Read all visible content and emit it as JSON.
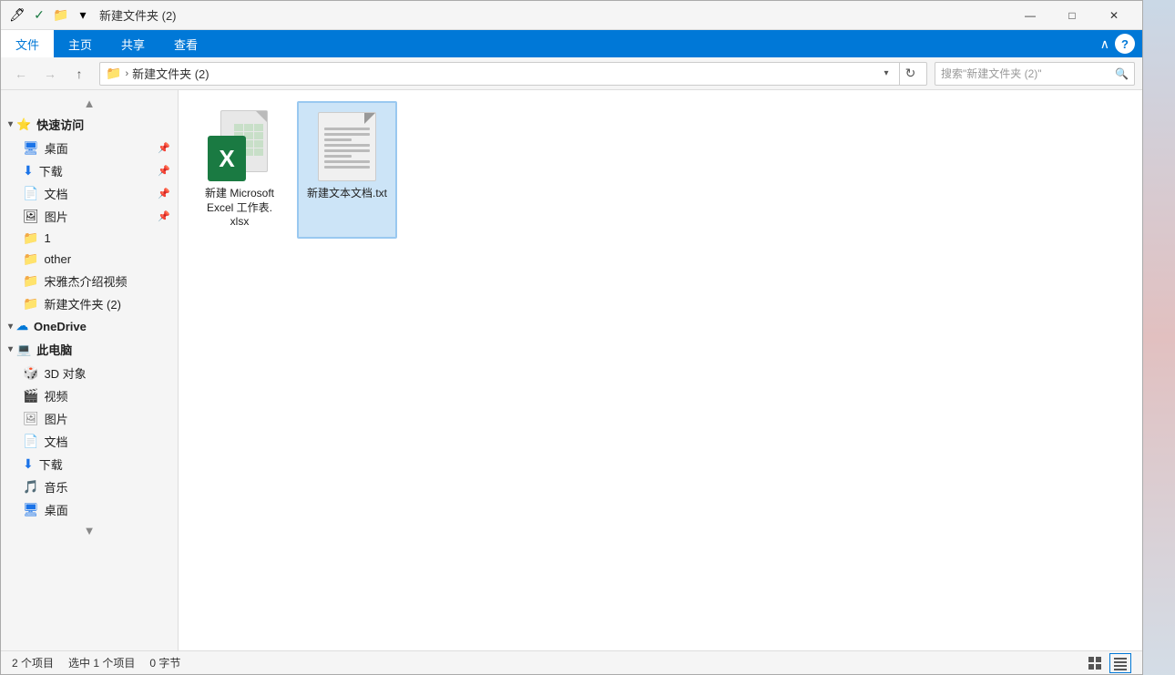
{
  "window": {
    "title": "新建文件夹 (2)",
    "titlebar_icons": [
      "🖊",
      "✓",
      "📁",
      "▾"
    ]
  },
  "menubar": {
    "items": [
      "文件",
      "主页",
      "共享",
      "查看"
    ],
    "active_index": 0
  },
  "navbar": {
    "back": "←",
    "forward": "→",
    "up": "↑",
    "address_path": "新建文件夹 (2)",
    "address_prefix": ">",
    "search_placeholder": "搜索\"新建文件夹 (2)\""
  },
  "sidebar": {
    "sections": [
      {
        "id": "quick-access",
        "label": "快速访问",
        "icon": "⭐",
        "expanded": true,
        "items": [
          {
            "label": "桌面",
            "icon": "🖥",
            "pinned": true
          },
          {
            "label": "下载",
            "icon": "⬇",
            "pinned": true
          },
          {
            "label": "文档",
            "icon": "📄",
            "pinned": true
          },
          {
            "label": "图片",
            "icon": "🖼",
            "pinned": true
          },
          {
            "label": "1",
            "icon": "📁",
            "pinned": false
          },
          {
            "label": "other",
            "icon": "📁",
            "pinned": false
          },
          {
            "label": "宋雅杰介绍视频",
            "icon": "📁",
            "pinned": false
          },
          {
            "label": "新建文件夹 (2)",
            "icon": "📁",
            "pinned": false
          }
        ]
      },
      {
        "id": "onedrive",
        "label": "OneDrive",
        "icon": "☁",
        "expanded": false,
        "items": []
      },
      {
        "id": "this-pc",
        "label": "此电脑",
        "icon": "💻",
        "expanded": true,
        "items": [
          {
            "label": "3D 对象",
            "icon": "🎲"
          },
          {
            "label": "视频",
            "icon": "🎬"
          },
          {
            "label": "图片",
            "icon": "🖼"
          },
          {
            "label": "文档",
            "icon": "📄"
          },
          {
            "label": "下载",
            "icon": "⬇"
          },
          {
            "label": "音乐",
            "icon": "🎵"
          },
          {
            "label": "桌面",
            "icon": "🖥"
          }
        ]
      }
    ]
  },
  "files": [
    {
      "id": "excel-file",
      "name": "新建 Microsoft Excel 工作表.xlsx",
      "type": "excel",
      "selected": false
    },
    {
      "id": "txt-file",
      "name": "新建文本文档.txt",
      "type": "txt",
      "selected": true
    }
  ],
  "statusbar": {
    "item_count": "2 个项目",
    "selected_count": "选中 1 个项目",
    "selected_size": "0 字节"
  },
  "titlebar_controls": {
    "minimize": "—",
    "maximize": "□",
    "close": "✕"
  }
}
